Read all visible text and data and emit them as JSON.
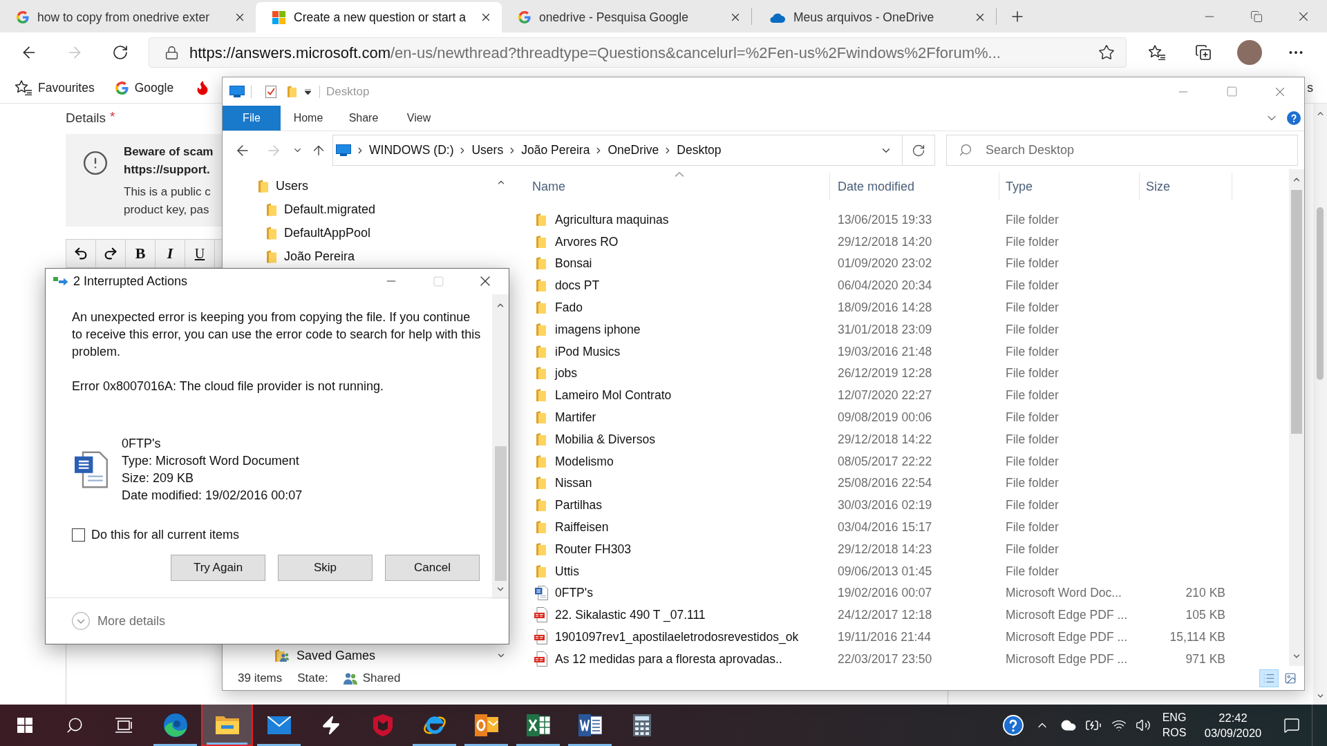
{
  "browser": {
    "tabs": [
      {
        "title": "how to copy from onedrive exter",
        "kind": "google",
        "selected": false
      },
      {
        "title": "Create a new question or start a",
        "kind": "microsoft",
        "selected": true
      },
      {
        "title": "onedrive - Pesquisa Google",
        "kind": "google",
        "selected": false
      },
      {
        "title": "Meus arquivos - OneDrive",
        "kind": "onedrive",
        "selected": false
      }
    ],
    "address": {
      "host": "https://answers.microsoft.com",
      "path": "/en-us/newthread?threadtype=Questions&cancelurl=%2Fen-us%2Fwindows%2Fforum%..."
    },
    "favourites": [
      {
        "label": "Favourites",
        "kind": "favourites"
      },
      {
        "label": "Google",
        "kind": "google"
      },
      {
        "kind": "flame"
      }
    ],
    "favourites_overflow": "s"
  },
  "page": {
    "heading": "Details",
    "required_mark": "*",
    "notice": {
      "title": [
        "Beware of scam",
        "https://support."
      ],
      "body": [
        "This is a public c",
        "product key, pas"
      ]
    },
    "editor_tools": [
      {
        "kind": "undo"
      },
      {
        "kind": "redo"
      },
      {
        "kind": "bold",
        "label": "B"
      },
      {
        "kind": "italic",
        "label": "I"
      },
      {
        "kind": "underline",
        "label": "U"
      }
    ]
  },
  "explorer": {
    "title": "Desktop",
    "ribbon_tabs": [
      {
        "label": "File",
        "kind": "file"
      },
      {
        "label": "Home",
        "kind": "tab"
      },
      {
        "label": "Share",
        "kind": "tab"
      },
      {
        "label": "View",
        "kind": "tab"
      }
    ],
    "breadcrumb": [
      "WINDOWS (D:)",
      "Users",
      "João Pereira",
      "OneDrive",
      "Desktop"
    ],
    "search": {
      "placeholder": "Search Desktop"
    },
    "nav_tree": [
      {
        "label": "Users",
        "kind": "folder",
        "children": [
          {
            "label": "Default.migrated",
            "kind": "folder"
          },
          {
            "label": "DefaultAppPool",
            "kind": "folder"
          },
          {
            "label": "João Pereira",
            "kind": "folder",
            "children": [
              {
                "label": "Saved Games",
                "kind": "shared_folder"
              }
            ]
          }
        ]
      }
    ],
    "columns": [
      {
        "label": "Name",
        "sorted": true
      },
      {
        "label": "Date modified",
        "sorted": false
      },
      {
        "label": "Type",
        "sorted": false
      },
      {
        "label": "Size",
        "sorted": false
      }
    ],
    "files": [
      {
        "name": "Agricultura maquinas",
        "date": "13/06/2015 19:33",
        "type": "File folder",
        "kind": "folder"
      },
      {
        "name": "Arvores RO",
        "date": "29/12/2018 14:20",
        "type": "File folder",
        "kind": "folder"
      },
      {
        "name": "Bonsai",
        "date": "01/09/2020 23:02",
        "type": "File folder",
        "kind": "folder"
      },
      {
        "name": "docs PT",
        "date": "06/04/2020 20:34",
        "type": "File folder",
        "kind": "folder"
      },
      {
        "name": "Fado",
        "date": "18/09/2016 14:28",
        "type": "File folder",
        "kind": "folder"
      },
      {
        "name": "imagens iphone",
        "date": "31/01/2018 23:09",
        "type": "File folder",
        "kind": "folder"
      },
      {
        "name": "iPod Musics",
        "date": "19/03/2016 21:48",
        "type": "File folder",
        "kind": "folder"
      },
      {
        "name": "jobs",
        "date": "26/12/2019 12:28",
        "type": "File folder",
        "kind": "folder"
      },
      {
        "name": "Lameiro Mol Contrato",
        "date": "12/07/2020 22:27",
        "type": "File folder",
        "kind": "folder"
      },
      {
        "name": "Martifer",
        "date": "09/08/2019 00:06",
        "type": "File folder",
        "kind": "folder"
      },
      {
        "name": "Mobilia & Diversos",
        "date": "29/12/2018 14:22",
        "type": "File folder",
        "kind": "folder"
      },
      {
        "name": "Modelismo",
        "date": "08/05/2017 22:22",
        "type": "File folder",
        "kind": "folder"
      },
      {
        "name": "Nissan",
        "date": "25/08/2016 22:54",
        "type": "File folder",
        "kind": "folder"
      },
      {
        "name": "Partilhas",
        "date": "30/03/2016 02:19",
        "type": "File folder",
        "kind": "folder"
      },
      {
        "name": "Raiffeisen",
        "date": "03/04/2016 15:17",
        "type": "File folder",
        "kind": "folder"
      },
      {
        "name": "Router FH303",
        "date": "29/12/2018 14:23",
        "type": "File folder",
        "kind": "folder"
      },
      {
        "name": "Uttis",
        "date": "09/06/2013 01:45",
        "type": "File folder",
        "kind": "folder"
      },
      {
        "name": "0FTP's",
        "date": "19/02/2016 00:07",
        "type": "Microsoft Word Doc...",
        "size": "210 KB",
        "kind": "word"
      },
      {
        "name": "22. Sikalastic 490 T _07.111",
        "date": "24/12/2017 12:18",
        "type": "Microsoft Edge PDF ...",
        "size": "105 KB",
        "kind": "pdf"
      },
      {
        "name": "1901097rev1_apostilaeletrodosrevestidos_ok",
        "date": "19/11/2016 21:44",
        "type": "Microsoft Edge PDF ...",
        "size": "15,114 KB",
        "kind": "pdf"
      },
      {
        "name": "As 12 medidas para a floresta aprovadas..",
        "date": "22/03/2017 23:50",
        "type": "Microsoft Edge PDF ...",
        "size": "971 KB",
        "kind": "pdf"
      }
    ],
    "status": {
      "count": "39 items",
      "state_label": "State:",
      "state": "Shared"
    },
    "view_buttons": [
      {
        "kind": "details",
        "selected": true
      },
      {
        "kind": "large_icons",
        "selected": false
      }
    ]
  },
  "dialog": {
    "title": "2 Interrupted Actions",
    "message": "An unexpected error is keeping you from copying the file. If you continue to receive this error, you can use the error code to search for help with this problem.",
    "error": "Error 0x8007016A: The cloud file provider is not running.",
    "file": {
      "name": "0FTP's",
      "type": "Type: Microsoft Word Document",
      "size": "Size: 209 KB",
      "modified": "Date modified: 19/02/2016 00:07"
    },
    "checkbox": {
      "label": "Do this for all current items",
      "checked": false
    },
    "buttons": [
      "Try Again",
      "Skip",
      "Cancel"
    ],
    "more_details": "More details"
  },
  "taskbar": {
    "apps": [
      {
        "kind": "edge",
        "running": true,
        "active": false
      },
      {
        "kind": "explorer",
        "running": true,
        "active": true
      },
      {
        "kind": "mail",
        "running": true,
        "active": false
      },
      {
        "kind": "bolt",
        "running": false,
        "active": false
      },
      {
        "kind": "shield",
        "running": false,
        "active": false
      },
      {
        "kind": "ie",
        "running": true,
        "active": false
      },
      {
        "kind": "outlook",
        "running": true,
        "active": false
      },
      {
        "kind": "excel",
        "running": true,
        "active": false
      },
      {
        "kind": "word",
        "running": true,
        "active": false
      },
      {
        "kind": "calculator",
        "running": false,
        "active": false
      }
    ],
    "language": [
      "ENG",
      "ROS"
    ],
    "time": "22:42",
    "date": "03/09/2020"
  }
}
